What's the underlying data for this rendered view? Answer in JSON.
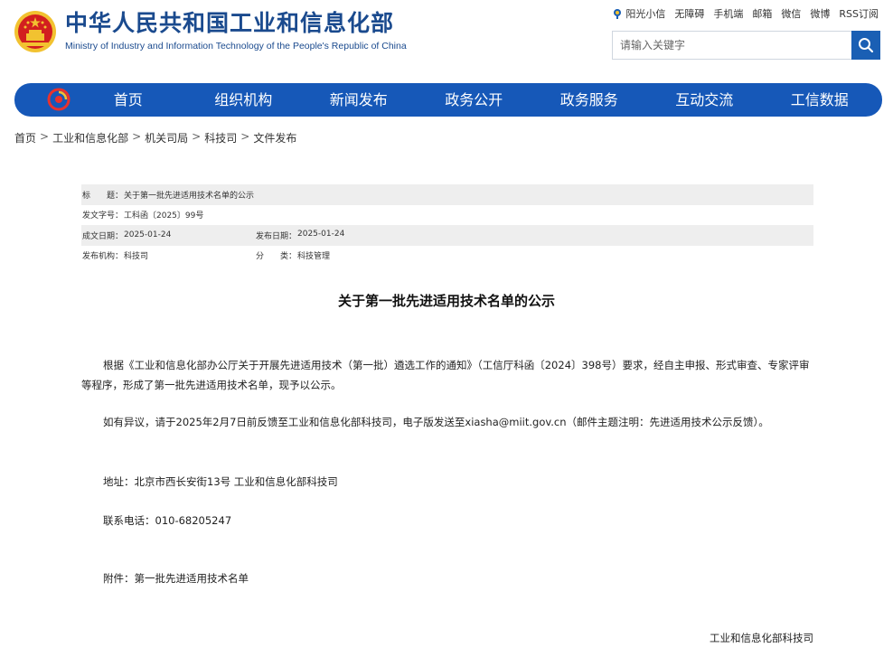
{
  "header": {
    "logo_cn": "中华人民共和国工业和信息化部",
    "logo_en": "Ministry of Industry and Information Technology of the People's Republic of China",
    "toplinks": [
      "阳光小信",
      "无障碍",
      "手机端",
      "邮箱",
      "微信",
      "微博",
      "RSS订阅"
    ],
    "search_placeholder": "请输入关键字"
  },
  "nav": {
    "items": [
      "首页",
      "组织机构",
      "新闻发布",
      "政务公开",
      "政务服务",
      "互动交流",
      "工信数据"
    ]
  },
  "breadcrumb": [
    "首页",
    "工业和信息化部",
    "机关司局",
    "科技司",
    "文件发布"
  ],
  "meta": {
    "title_label": "标　　题：",
    "title_value": "关于第一批先进适用技术名单的公示",
    "docno_label": "发文字号：",
    "docno_value": "工科函〔2025〕99号",
    "created_label": "成文日期：",
    "created_value": "2025-01-24",
    "published_label": "发布日期：",
    "published_value": "2025-01-24",
    "org_label": "发布机构：",
    "org_value": "科技司",
    "category_label": "分　　类：",
    "category_value": "科技管理"
  },
  "article": {
    "title": "关于第一批先进适用技术名单的公示",
    "p1": "根据《工业和信息化部办公厅关于开展先进适用技术（第一批）遴选工作的通知》（工信厅科函〔2024〕398号）要求，经自主申报、形式审查、专家评审等程序，形成了第一批先进适用技术名单，现予以公示。",
    "p2": "如有异议，请于2025年2月7日前反馈至工业和信息化部科技司，电子版发送至xiasha@miit.gov.cn（邮件主题注明：先进适用技术公示反馈）。",
    "address": "地址：北京市西长安街13号 工业和信息化部科技司",
    "phone": "联系电话：010-68205247",
    "attachment": "附件：第一批先进适用技术名单",
    "signature": "工业和信息化部科技司"
  },
  "colors": {
    "nav_bg": "#1658b8",
    "logo_text": "#1a4a8e",
    "emblem_red": "#d21f1f",
    "emblem_gold": "#f2c230"
  }
}
